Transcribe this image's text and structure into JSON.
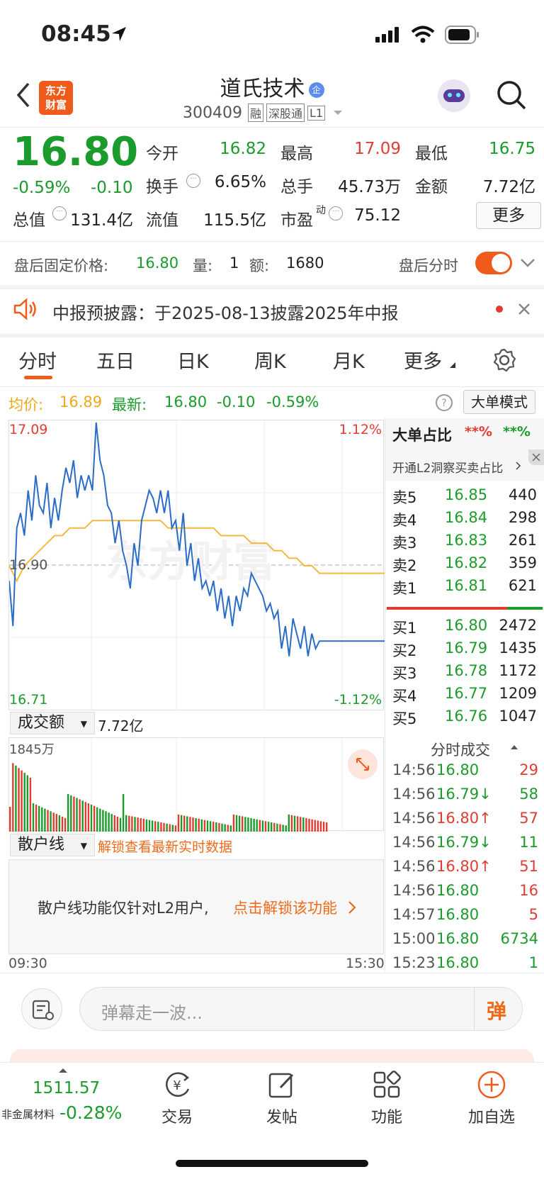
{
  "status_bar": {
    "time": "08:45"
  },
  "header": {
    "stock_name": "道氏技术",
    "stock_code": "300409",
    "tags": [
      "融",
      "深股通",
      "L1"
    ],
    "logo_text_line1": "东方",
    "logo_text_line2": "财富",
    "badge": "企"
  },
  "quote": {
    "price": "16.80",
    "change_pct": "-0.59%",
    "change": "-0.10",
    "open_label": "今开",
    "open": "16.82",
    "high_label": "最高",
    "high": "17.09",
    "low_label": "最低",
    "low": "16.75",
    "turnover_label": "换手",
    "turnover": "6.65%",
    "volume_label": "总手",
    "volume": "45.73万",
    "amount_label": "金额",
    "amount": "7.72亿",
    "mktcap_label": "总值",
    "mktcap": "131.4亿",
    "float_label": "流值",
    "float_cap": "115.5亿",
    "pe_label": "市盈",
    "pe_sup": "动",
    "pe": "75.12",
    "more_button": "更多"
  },
  "after_hours": {
    "label": "盘后固定价格:",
    "price": "16.80",
    "vol_label": "量:",
    "vol": "1",
    "amt_label": "额:",
    "amt": "1680",
    "toggle_label": "盘后分时",
    "toggle_on": true
  },
  "notice": {
    "text": "中报预披露：于2025-08-13披露2025年中报"
  },
  "tabs": [
    "分时",
    "五日",
    "日K",
    "周K",
    "月K",
    "更多"
  ],
  "active_tab": 0,
  "chart_header": {
    "avg_label": "均价:",
    "avg": "16.89",
    "latest_label": "最新:",
    "latest": "16.80",
    "latest_chg": "-0.10",
    "latest_pct": "-0.59%",
    "mode_button": "大单模式"
  },
  "chart_data": {
    "type": "line",
    "x_start": "09:30",
    "x_end": "15:30",
    "y_max": "17.09",
    "y_min": "16.71",
    "y_ref": "16.90",
    "pct_max": "1.12%",
    "pct_min": "-1.12%",
    "series": [
      {
        "values": [
          16.88,
          16.82,
          16.95,
          16.97,
          16.94,
          17.0,
          16.96,
          17.02,
          16.98,
          16.97,
          17.01,
          16.95,
          16.99,
          16.96,
          17.0,
          17.03,
          17.01,
          17.04,
          16.99,
          17.02,
          17.0,
          17.02,
          17.0,
          17.09,
          17.04,
          17.02,
          16.98,
          16.97,
          16.93,
          16.96,
          16.92,
          16.9,
          16.87,
          16.93,
          16.9,
          16.96,
          16.98,
          17.0,
          16.99,
          16.97,
          17.0,
          16.97,
          17.0,
          16.95,
          16.96,
          16.92,
          16.97,
          16.9,
          16.93,
          16.88,
          16.91,
          16.87,
          16.88,
          16.86,
          16.88,
          16.84,
          16.87,
          16.83,
          16.86,
          16.82,
          16.86,
          16.84,
          16.87,
          16.86,
          16.89,
          16.88,
          16.87,
          16.86,
          16.84,
          16.85,
          16.83,
          16.84,
          16.79,
          16.82,
          16.78,
          16.83,
          16.81,
          16.79,
          16.82,
          16.78,
          16.81,
          16.79,
          16.8,
          16.8,
          16.8,
          16.8,
          16.8,
          16.8,
          16.8
        ]
      },
      {
        "name": "均价",
        "values": [
          16.9,
          16.88,
          16.9,
          16.91,
          16.92,
          16.93,
          16.94,
          16.94,
          16.95,
          16.95,
          16.95,
          16.96,
          16.96,
          16.96,
          16.96,
          16.96,
          16.96,
          16.96,
          16.96,
          16.96,
          16.96,
          16.95,
          16.95,
          16.95,
          16.95,
          16.95,
          16.95,
          16.95,
          16.94,
          16.94,
          16.94,
          16.94,
          16.93,
          16.93,
          16.93,
          16.92,
          16.92,
          16.91,
          16.91,
          16.9,
          16.9,
          16.89,
          16.89,
          16.89,
          16.89
        ]
      }
    ],
    "amount_label": "成交额",
    "amount_total": "7.72亿",
    "amount_max": "1845万"
  },
  "retail": {
    "label": "散户线",
    "unlock_text": "解锁查看最新实时数据",
    "info_text": "散户线功能仅针对L2用户,",
    "info_link": "点击解锁该功能"
  },
  "order_book": {
    "title": "大单占比",
    "red_val": "**%",
    "green_val": "**%",
    "promo": "开通L2洞察买卖占比",
    "asks": [
      {
        "label": "卖5",
        "price": "16.85",
        "vol": "440"
      },
      {
        "label": "卖4",
        "price": "16.84",
        "vol": "298"
      },
      {
        "label": "卖3",
        "price": "16.83",
        "vol": "261"
      },
      {
        "label": "卖2",
        "price": "16.82",
        "vol": "359"
      },
      {
        "label": "卖1",
        "price": "16.81",
        "vol": "621"
      }
    ],
    "bids": [
      {
        "label": "买1",
        "price": "16.80",
        "vol": "2472"
      },
      {
        "label": "买2",
        "price": "16.79",
        "vol": "1435"
      },
      {
        "label": "买3",
        "price": "16.78",
        "vol": "1172"
      },
      {
        "label": "买4",
        "price": "16.77",
        "vol": "1209"
      },
      {
        "label": "买5",
        "price": "16.76",
        "vol": "1047"
      }
    ]
  },
  "ticks": {
    "title": "分时成交",
    "rows": [
      {
        "time": "14:56",
        "price": "16.80",
        "vol": "29",
        "dir": ""
      },
      {
        "time": "14:56",
        "price": "16.79↓",
        "vol": "58",
        "dir": "down"
      },
      {
        "time": "14:56",
        "price": "16.80↑",
        "vol": "57",
        "dir": "up"
      },
      {
        "time": "14:56",
        "price": "16.79↓",
        "vol": "11",
        "dir": "down"
      },
      {
        "time": "14:56",
        "price": "16.80↑",
        "vol": "51",
        "dir": "up"
      },
      {
        "time": "14:56",
        "price": "16.80",
        "vol": "16",
        "dir": ""
      },
      {
        "time": "14:57",
        "price": "16.80",
        "vol": "5",
        "dir": ""
      },
      {
        "time": "15:00",
        "price": "16.80",
        "vol": "6734",
        "dir": ""
      },
      {
        "time": "15:23",
        "price": "16.80",
        "vol": "1",
        "dir": ""
      }
    ]
  },
  "comment": {
    "placeholder": "弹幕走一波...",
    "send_icon_text": "弹"
  },
  "bottom_nav": {
    "index_value": "1511.57",
    "index_name": "非金属材料",
    "index_pct": "-0.28%",
    "items": [
      "交易",
      "发帖",
      "功能",
      "加自选"
    ]
  }
}
